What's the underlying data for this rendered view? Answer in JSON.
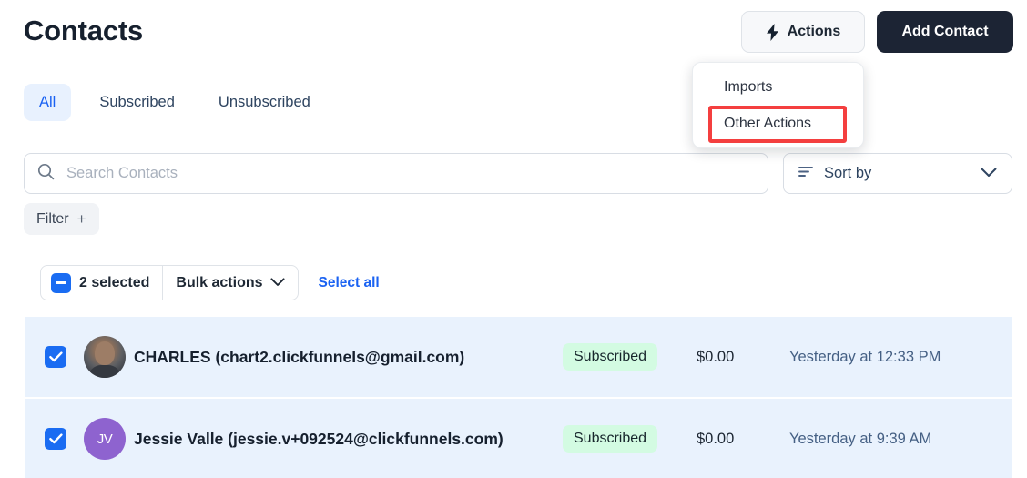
{
  "header": {
    "title": "Contacts",
    "actions_button": {
      "label": "Actions",
      "icon": "bolt-icon"
    },
    "add_contact_button": {
      "label": "Add Contact"
    }
  },
  "actions_dropdown": {
    "visible": true,
    "items": [
      {
        "label": "Imports",
        "highlighted": false
      },
      {
        "label": "Other Actions",
        "highlighted": true
      }
    ],
    "highlight_color": "#f43f3f"
  },
  "tabs": [
    {
      "label": "All",
      "active": true
    },
    {
      "label": "Subscribed",
      "active": false
    },
    {
      "label": "Unsubscribed",
      "active": false
    }
  ],
  "search": {
    "placeholder": "Search Contacts",
    "value": "",
    "icon": "search-icon"
  },
  "sort": {
    "label": "Sort by",
    "icon": "sort-icon",
    "chevron": "chevron-down-icon"
  },
  "filter": {
    "label": "Filter",
    "plus": "+"
  },
  "bulkbar": {
    "selected_label": "2 selected",
    "bulk_actions_label": "Bulk actions",
    "select_all_label": "Select all",
    "checkbox_state": "indeterminate",
    "accent_color": "#1a6cf2"
  },
  "contacts": {
    "rows": [
      {
        "checked": true,
        "avatar_type": "photo",
        "avatar_initials": "",
        "name": "CHARLES (chart2.clickfunnels@gmail.com)",
        "status": "Subscribed",
        "amount": "$0.00",
        "timestamp": "Yesterday at 12:33 PM"
      },
      {
        "checked": true,
        "avatar_type": "initials",
        "avatar_initials": "JV",
        "name": "Jessie Valle (jessie.v+092524@clickfunnels.com)",
        "status": "Subscribed",
        "amount": "$0.00",
        "timestamp": "Yesterday at 9:39 AM"
      }
    ],
    "row_background": "#e9f2fd",
    "badge_background": "#d3fbe2"
  }
}
